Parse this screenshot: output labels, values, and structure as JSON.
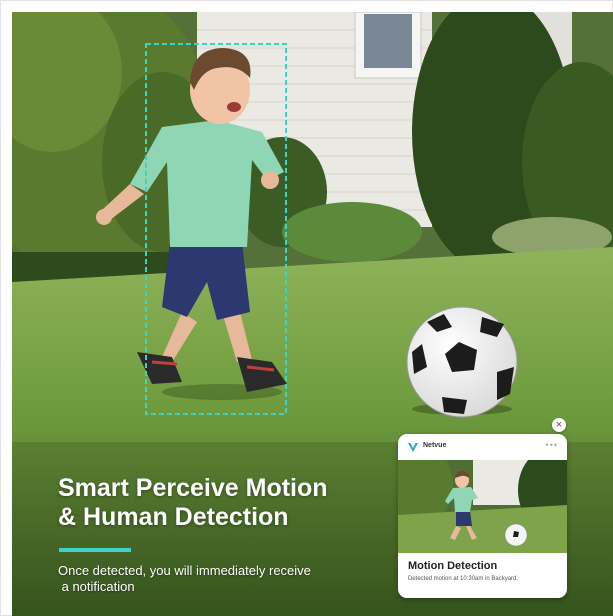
{
  "headline": {
    "line1": "Smart Perceive Motion",
    "line2": "& Human Detection"
  },
  "subtext": {
    "line1": "Once detected, you will immediately receive",
    "line2": " a notification"
  },
  "notification": {
    "app_name": "Netvue",
    "title": "Motion Detection",
    "description": "Detected motion at 10:30am in Backyard.",
    "close_glyph": "×",
    "more_glyph": "•••"
  },
  "colors": {
    "accent": "#3fd3c8",
    "grass": "#6d9a3f",
    "house": "#eceae4",
    "detection_box": "#3fd3c8"
  },
  "icons": {
    "app_logo": "netvue-logo-icon",
    "close": "close-icon",
    "more": "more-icon"
  }
}
